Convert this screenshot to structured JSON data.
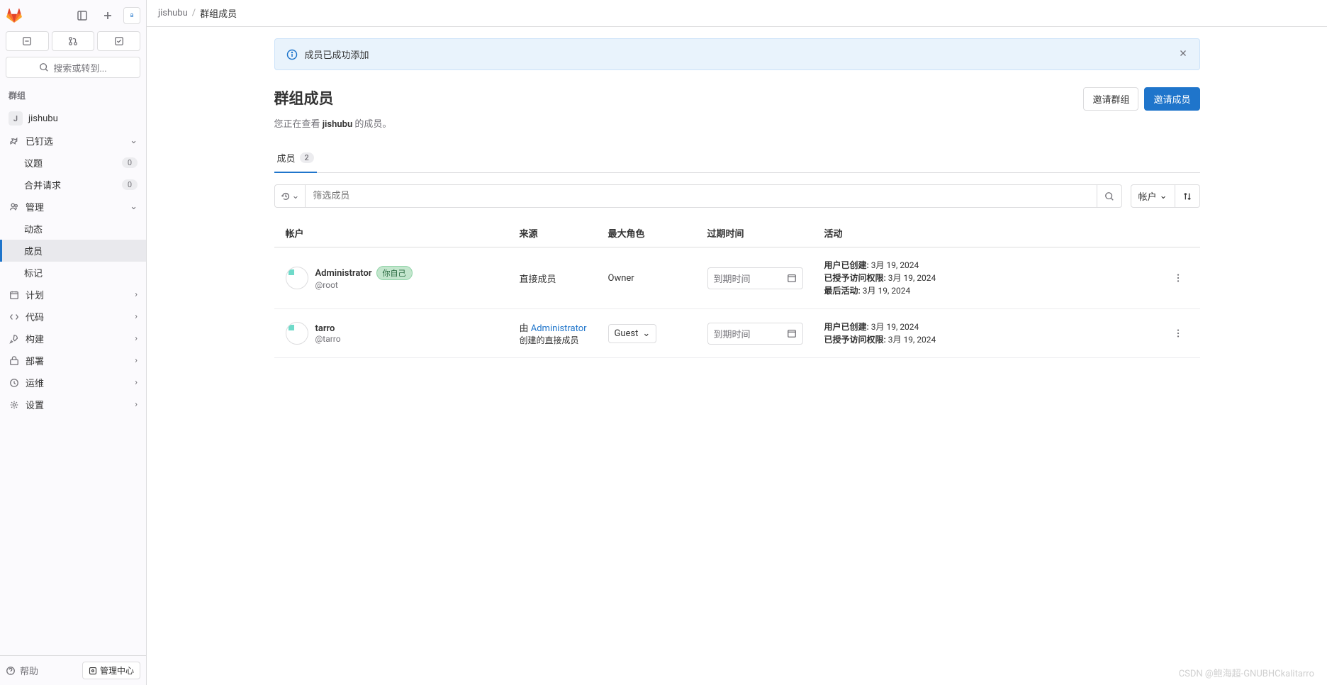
{
  "sidebar": {
    "search_placeholder": "搜索或转到...",
    "section_group": "群组",
    "group_name": "jishubu",
    "group_initial": "J",
    "pinned": {
      "label": "已钉选"
    },
    "issues": {
      "label": "议题",
      "count": "0"
    },
    "merge_requests": {
      "label": "合并请求",
      "count": "0"
    },
    "manage": {
      "label": "管理"
    },
    "manage_items": {
      "activity": "动态",
      "members": "成员",
      "labels": "标记"
    },
    "plan": "计划",
    "code": "代码",
    "build": "构建",
    "deploy": "部署",
    "operate": "运维",
    "settings": "设置",
    "help": "帮助",
    "admin": "管理中心"
  },
  "breadcrumb": {
    "group": "jishubu",
    "page": "群组成员"
  },
  "alert": {
    "text": "成员已成功添加"
  },
  "page": {
    "title": "群组成员",
    "subtitle_pre": "您正在查看 ",
    "subtitle_bold": "jishubu",
    "subtitle_post": " 的成员。",
    "invite_group": "邀请群组",
    "invite_member": "邀请成员"
  },
  "tabs": {
    "members": "成员",
    "members_count": "2"
  },
  "filter": {
    "placeholder": "筛选成员",
    "sort_label": "帐户"
  },
  "columns": {
    "account": "帐户",
    "source": "来源",
    "role": "最大角色",
    "expiration": "过期时间",
    "activity": "活动"
  },
  "expire_placeholder": "到期时间",
  "labels": {
    "user_created": "用户已创建:",
    "access_granted": "已授予访问权限:",
    "last_activity": "最后活动:",
    "you": "你自己",
    "by": "由 ",
    "direct_member_suffix": "创建的直接成员"
  },
  "members": [
    {
      "name": "Administrator",
      "username": "@root",
      "is_you": true,
      "source_text": "直接成员",
      "role_text": "Owner",
      "activity": {
        "created": "3月 19, 2024",
        "granted": "3月 19, 2024",
        "last": "3月 19, 2024"
      }
    },
    {
      "name": "tarro",
      "username": "@tarro",
      "is_you": false,
      "source_by": "Administrator",
      "role_select": "Guest",
      "activity": {
        "created": "3月 19, 2024",
        "granted": "3月 19, 2024"
      }
    }
  ],
  "watermark": "CSDN @鲍海超-GNUBHCkalitarro"
}
